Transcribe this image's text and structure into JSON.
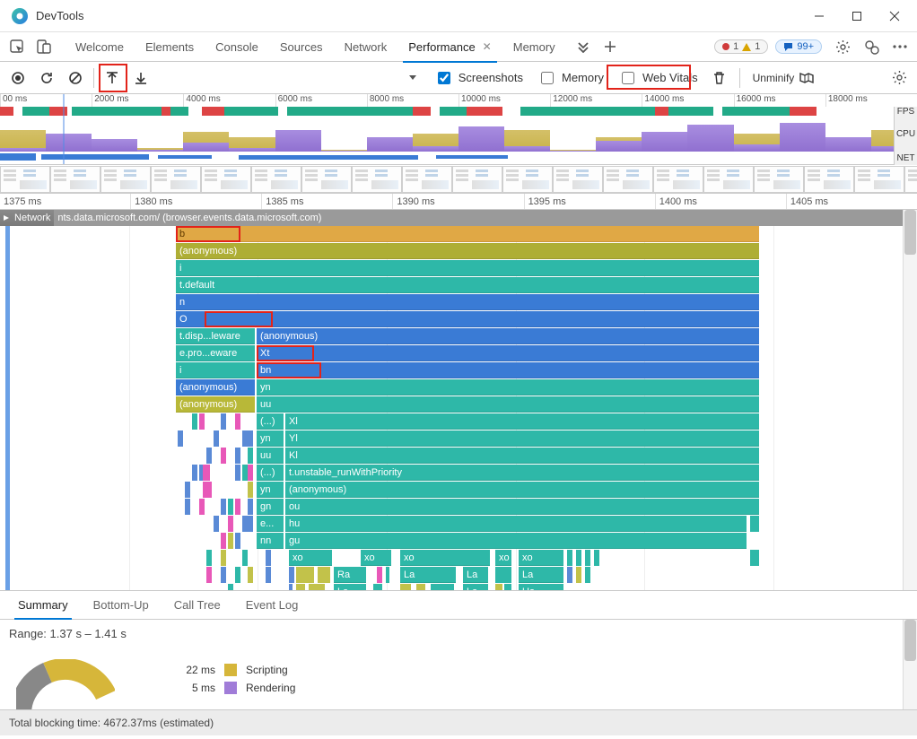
{
  "titlebar": {
    "app_name": "DevTools"
  },
  "tabs": {
    "list": [
      "Welcome",
      "Elements",
      "Console",
      "Sources",
      "Network",
      "Performance",
      "Memory"
    ],
    "active": "Performance",
    "welcome": "Welcome",
    "elements": "Elements",
    "console": "Console",
    "sources": "Sources",
    "network": "Network",
    "performance": "Performance",
    "memory": "Memory"
  },
  "counters": {
    "errors": "1",
    "warnings": "1",
    "info": "99+"
  },
  "toolbar": {
    "screenshots": "Screenshots",
    "memory": "Memory",
    "webvitals": "Web Vitals",
    "unminify": "Unminify"
  },
  "overview_ticks": [
    "00 ms",
    "2000 ms",
    "4000 ms",
    "6000 ms",
    "8000 ms",
    "10000 ms",
    "12000 ms",
    "14000 ms",
    "16000 ms",
    "18000 ms"
  ],
  "overview_lanes": {
    "fps": "FPS",
    "cpu": "CPU",
    "net": "NET"
  },
  "ruler": [
    "1375 ms",
    "1380 ms",
    "1385 ms",
    "1390 ms",
    "1395 ms",
    "1400 ms",
    "1405 ms"
  ],
  "network_row": {
    "label": "Network",
    "url": "nts.data.microsoft.com/ (browser.events.data.microsoft.com)"
  },
  "f": {
    "b": "b",
    "anon": "(anonymous)",
    "i": "i",
    "tdefault": "t.default",
    "n": "n",
    "o": "O",
    "tdisp": "t.disp...leware",
    "epro": "e.pro...eware",
    "xt": "Xt",
    "bn": "bn",
    "yn": "yn",
    "uu": "uu",
    "paren": "(...)",
    "xl": "Xl",
    "yl": "Yl",
    "kl": "Kl",
    "tunstable": "t.unstable_runWithPriority",
    "gn": "gn",
    "ou": "ou",
    "e": "e...",
    "hu": "hu",
    "nn": "nn",
    "gu": "gu",
    "xo": "xo",
    "ra": "Ra",
    "la": "La",
    "ua": "Ua"
  },
  "bottom_tabs": {
    "summary": "Summary",
    "bottomup": "Bottom-Up",
    "calltree": "Call Tree",
    "eventlog": "Event Log"
  },
  "summary": {
    "range": "Range: 1.37 s – 1.41 s",
    "items": [
      {
        "dur": "22 ms",
        "label": "Scripting",
        "color": "#d6b63a"
      },
      {
        "dur": "5 ms",
        "label": "Rendering",
        "color": "#a07cd8"
      }
    ]
  },
  "footer": {
    "blocking": "Total blocking time: 4672.37ms (estimated)"
  }
}
